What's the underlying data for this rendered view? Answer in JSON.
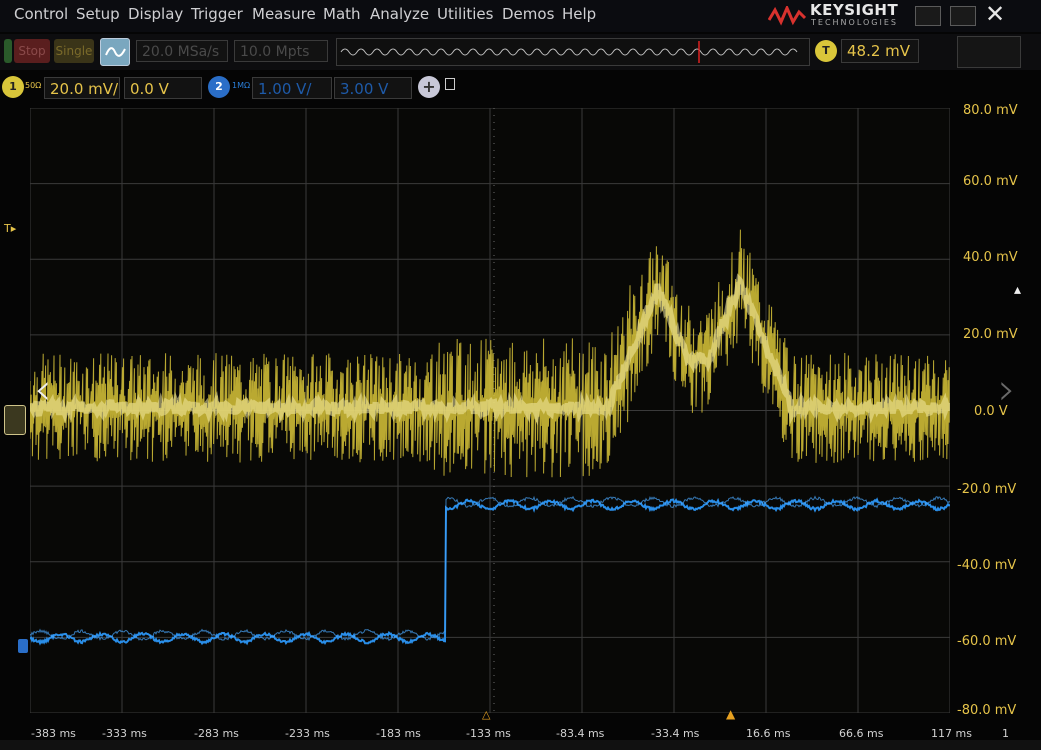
{
  "menu": [
    "Control",
    "Setup",
    "Display",
    "Trigger",
    "Measure",
    "Math",
    "Analyze",
    "Utilities",
    "Demos",
    "Help"
  ],
  "brand": {
    "name": "KEYSIGHT",
    "sub": "TECHNOLOGIES"
  },
  "window": {
    "close": "✕"
  },
  "toolbar": {
    "run_stop": "Stop",
    "single": "Single",
    "sample_rate": "20.0 MSa/s",
    "memory_depth": "10.0 Mpts",
    "trigger_badge": "T",
    "trigger_level": "48.2 mV"
  },
  "channels": {
    "ch1": {
      "badge": "1",
      "impedance": "50Ω",
      "scale": "20.0 mV/",
      "offset": "0.0 V",
      "color": "#d9c63a"
    },
    "ch2": {
      "badge": "2",
      "impedance": "1MΩ",
      "scale": "1.00 V/",
      "offset": "3.00 V",
      "color": "#2a8ee8"
    },
    "add_label": "+"
  },
  "y_axis": [
    "80.0 mV",
    "60.0 mV",
    "40.0 mV",
    "20.0 mV",
    "0.0 V",
    "-20.0 mV",
    "-40.0 mV",
    "-60.0 mV",
    "-80.0 mV"
  ],
  "x_axis": [
    "-383 ms",
    "-333 ms",
    "-283 ms",
    "-233 ms",
    "-183 ms",
    "-133 ms",
    "-83.4 ms",
    "-33.4 ms",
    "16.6 ms",
    "66.6 ms",
    "117 ms"
  ],
  "x_axis_end_label": "1",
  "markers": {
    "trigger": "T"
  },
  "colors": {
    "yellow": "#d9c63a",
    "blue": "#2a8ee8",
    "grid": "#3a3a3a",
    "background": "#050505"
  }
}
